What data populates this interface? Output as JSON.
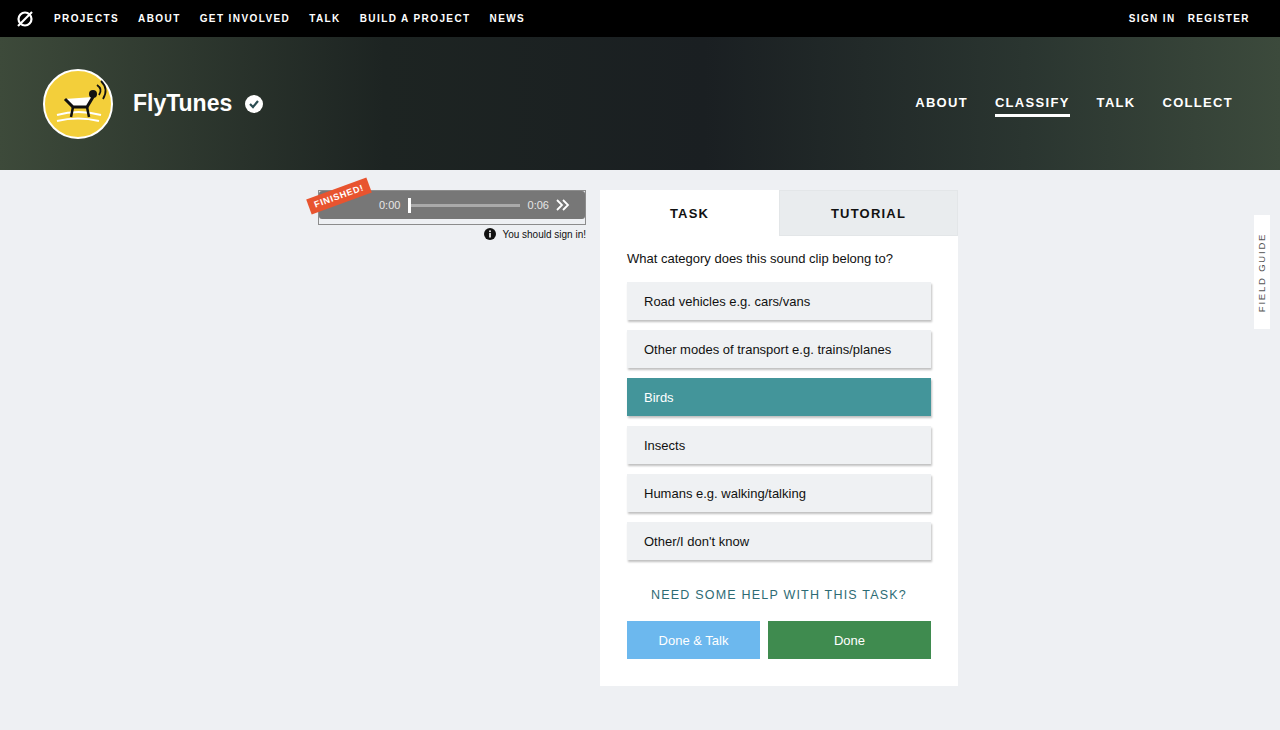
{
  "site_nav": {
    "items": [
      "PROJECTS",
      "ABOUT",
      "GET INVOLVED",
      "TALK",
      "BUILD A PROJECT",
      "NEWS"
    ],
    "right": [
      "SIGN IN",
      "REGISTER"
    ]
  },
  "project": {
    "name": "FlyTunes",
    "verified": true,
    "tabs": [
      {
        "label": "ABOUT",
        "selected": false
      },
      {
        "label": "CLASSIFY",
        "selected": true
      },
      {
        "label": "TALK",
        "selected": false
      },
      {
        "label": "COLLECT",
        "selected": false
      }
    ]
  },
  "player": {
    "badge": "FINISHED!",
    "current": "0:00",
    "duration": "0:06",
    "level": 0,
    "notice": "You should sign in!"
  },
  "task_panel": {
    "tabs": [
      {
        "label": "TASK",
        "selected": true
      },
      {
        "label": "TUTORIAL",
        "selected": false
      }
    ],
    "question": "What category does this sound clip belong to?",
    "options": [
      {
        "label": "Road vehicles e.g. cars/vans",
        "selected": false
      },
      {
        "label": "Other modes of transport e.g. trains/planes",
        "selected": false
      },
      {
        "label": "Birds",
        "selected": true
      },
      {
        "label": "Insects",
        "selected": false
      },
      {
        "label": "Humans e.g. walking/talking",
        "selected": false
      },
      {
        "label": "Other/I don't know",
        "selected": false
      }
    ],
    "help": "NEED SOME HELP WITH THIS TASK?",
    "buttons": [
      "Done & Talk",
      "Done"
    ]
  },
  "field_guide": "FIELD GUIDE"
}
